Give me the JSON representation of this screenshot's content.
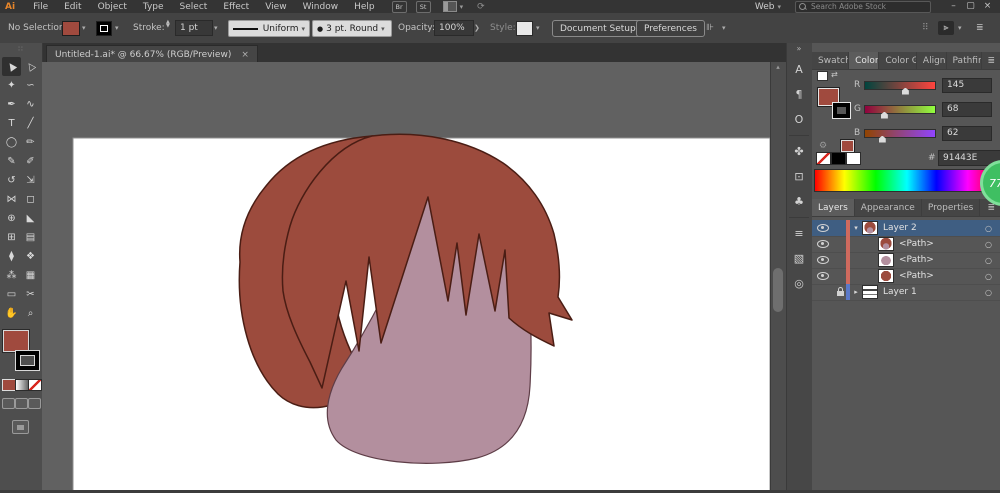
{
  "app": {
    "logo": "Ai"
  },
  "menu_bar": {
    "items": [
      "File",
      "Edit",
      "Object",
      "Type",
      "Select",
      "Effect",
      "View",
      "Window",
      "Help"
    ],
    "bridge": "Br",
    "stock": "St",
    "workspace": "Web",
    "search_placeholder": "Search Adobe Stock",
    "minimize": "–",
    "maximize": "▢",
    "close": "×"
  },
  "control_bar": {
    "selection_status": "No Selection",
    "stroke_label": "Stroke:",
    "stroke_weight": "1 pt",
    "width_profile": "Uniform",
    "brush": "3 pt. Round",
    "opacity_label": "Opacity:",
    "opacity_value": "100%",
    "more_arrow": "❯",
    "style_label": "Style:",
    "document_setup": "Document Setup",
    "preferences": "Preferences"
  },
  "document_tab": {
    "title": "Untitled-1.ai* @ 66.67% (RGB/Preview)",
    "close": "×"
  },
  "toolbar": {
    "tools": [
      {
        "name": "selection",
        "glyph": "▲"
      },
      {
        "name": "direct-selection",
        "glyph": "△"
      },
      {
        "name": "magic-wand",
        "glyph": "✦"
      },
      {
        "name": "lasso",
        "glyph": "∽"
      },
      {
        "name": "pen",
        "glyph": "✒"
      },
      {
        "name": "curvature",
        "glyph": "∿"
      },
      {
        "name": "type",
        "glyph": "T"
      },
      {
        "name": "line-segment",
        "glyph": "╱"
      },
      {
        "name": "ellipse",
        "glyph": "◯"
      },
      {
        "name": "paintbrush",
        "glyph": "✏"
      },
      {
        "name": "pencil",
        "glyph": "✎"
      },
      {
        "name": "shaper",
        "glyph": "✐"
      },
      {
        "name": "rotate",
        "glyph": "↺"
      },
      {
        "name": "scale",
        "glyph": "⇲"
      },
      {
        "name": "width",
        "glyph": "⋈"
      },
      {
        "name": "free-transform",
        "glyph": "◻"
      },
      {
        "name": "shape-builder",
        "glyph": "⊕"
      },
      {
        "name": "perspective-grid",
        "glyph": "◣"
      },
      {
        "name": "mesh",
        "glyph": "⊞"
      },
      {
        "name": "gradient",
        "glyph": "▤"
      },
      {
        "name": "eyedropper",
        "glyph": "⧫"
      },
      {
        "name": "blend",
        "glyph": "❖"
      },
      {
        "name": "symbol-sprayer",
        "glyph": "⁂"
      },
      {
        "name": "graph",
        "glyph": "▦"
      },
      {
        "name": "artboard",
        "glyph": "▭"
      },
      {
        "name": "slice",
        "glyph": "✂"
      },
      {
        "name": "hand",
        "glyph": "✋"
      },
      {
        "name": "zoom",
        "glyph": "⌕"
      }
    ]
  },
  "dock": {
    "collapse": "»",
    "icons": [
      {
        "name": "character",
        "glyph": "A"
      },
      {
        "name": "paragraph",
        "glyph": "¶"
      },
      {
        "name": "opentype",
        "glyph": "O"
      },
      {
        "name": "symbols",
        "glyph": "✤"
      },
      {
        "name": "artboards",
        "glyph": "⊡"
      },
      {
        "name": "brushes",
        "glyph": "♣"
      },
      {
        "name": "stroke",
        "glyph": "≡"
      },
      {
        "name": "image-trace",
        "glyph": "▧"
      },
      {
        "name": "links",
        "glyph": "◎"
      }
    ]
  },
  "color_panel": {
    "tabs": [
      "Swatch",
      "Color",
      "Color G",
      "Align",
      "Pathfin"
    ],
    "channels": [
      {
        "label": "R",
        "value": "145",
        "pos": "57%"
      },
      {
        "label": "G",
        "value": "68",
        "pos": "27%"
      },
      {
        "label": "B",
        "value": "62",
        "pos": "24%"
      }
    ],
    "hex_label": "#",
    "hex": "91443E"
  },
  "layers_panel": {
    "tabs": [
      "Layers",
      "Appearance",
      "Properties"
    ],
    "rows": [
      {
        "name": "Layer 2",
        "type": "layer",
        "selected": true
      },
      {
        "name": "<Path>",
        "type": "path"
      },
      {
        "name": "<Path>",
        "type": "path"
      },
      {
        "name": "<Path>",
        "type": "path"
      },
      {
        "name": "Layer 1",
        "type": "layer",
        "locked": true
      }
    ],
    "target_glyph": "○"
  },
  "badge": {
    "text": "77"
  },
  "artwork": {
    "hair_fill": "#9c4b3d",
    "hair_stroke": "#4a1d14",
    "face_fill": "#b38f9e",
    "face_stroke": "#5e3d47",
    "artboard": "#ffffff",
    "pasteboard": "#616161"
  }
}
